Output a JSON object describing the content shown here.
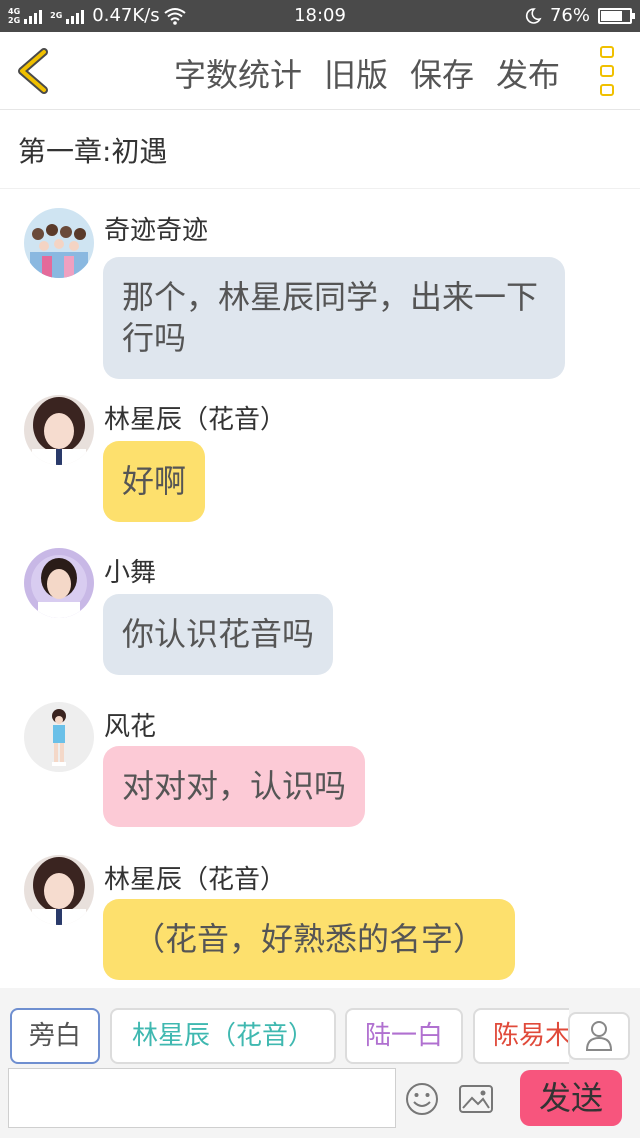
{
  "status_bar": {
    "net_top": "4G",
    "net_bottom": "2G",
    "net2": "2G",
    "speed": "0.47K/s",
    "time": "18:09",
    "battery_percent": "76%",
    "battery_level": 0.76
  },
  "toolbar": {
    "word_count": "字数统计",
    "old_version": "旧版",
    "save": "保存",
    "publish": "发布"
  },
  "chapter_title": "第一章:初遇",
  "messages": [
    {
      "sender": "奇迹奇迹",
      "text": "那个，林星辰同学，出来一下行吗",
      "bubble_color": "#dfe6ee"
    },
    {
      "sender": "林星辰（花音）",
      "text": "好啊",
      "bubble_color": "#fde06d"
    },
    {
      "sender": "小舞",
      "text": "你认识花音吗",
      "bubble_color": "#dfe6ee"
    },
    {
      "sender": "风花",
      "text": "对对对，认识吗",
      "bubble_color": "#fccad6"
    },
    {
      "sender": "林星辰（花音）",
      "text": "（花音，好熟悉的名字）",
      "bubble_color": "#fde06d"
    }
  ],
  "characters": [
    {
      "name": "旁白",
      "color": "#555555",
      "selected": true
    },
    {
      "name": "林星辰（花音）",
      "color": "#3fb8b0",
      "selected": false
    },
    {
      "name": "陆一白",
      "color": "#b070d0",
      "selected": false
    },
    {
      "name": "陈易木",
      "color": "#e04a3a",
      "selected": false
    }
  ],
  "input": {
    "value": "",
    "placeholder": ""
  },
  "send_label": "发送",
  "colors": {
    "accent_yellow": "#f0c000",
    "send_button": "#f7557d"
  }
}
